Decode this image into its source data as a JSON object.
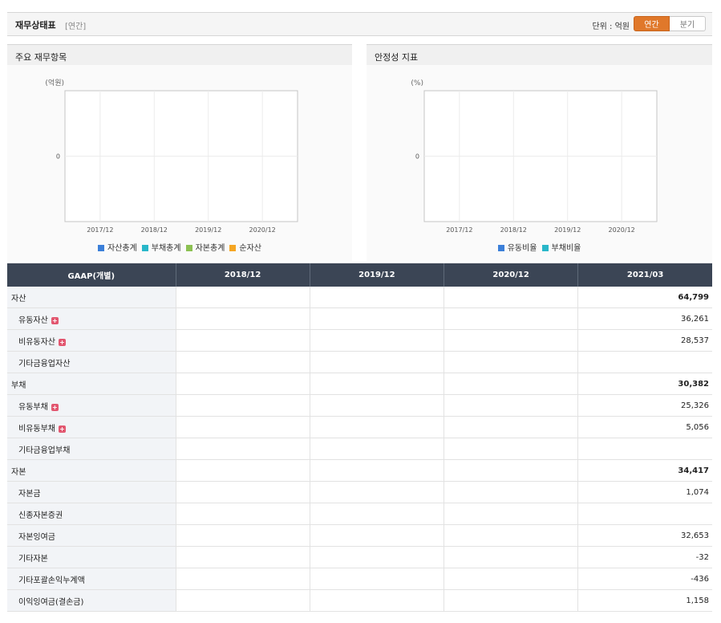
{
  "header": {
    "title": "재무상태표",
    "subtitle": "[연간]",
    "unit": "단위 : 억원",
    "toggle": {
      "annual": "연간",
      "quarter": "분기",
      "selected": "연간"
    }
  },
  "colors": {
    "accent": "#e0782a",
    "table_header_bg": "#3b4555",
    "negative": "#e03c3c",
    "legend_blue": "#3b7fd9",
    "legend_cyan": "#29b7c9",
    "legend_green": "#8cc152",
    "legend_orange": "#f5a623"
  },
  "chart_data": [
    {
      "type": "bar",
      "title": "주요 재무항목",
      "ylabel": "(억원)",
      "categories": [
        "2017/12",
        "2018/12",
        "2019/12",
        "2020/12"
      ],
      "y_ticks": [
        "0"
      ],
      "grid": true,
      "legend_position": "bottom",
      "series": [
        {
          "name": "자산총계",
          "color": "#3b7fd9",
          "values": []
        },
        {
          "name": "부채총계",
          "color": "#29b7c9",
          "values": []
        },
        {
          "name": "자본총계",
          "color": "#8cc152",
          "values": []
        },
        {
          "name": "순자산",
          "color": "#f5a623",
          "values": []
        }
      ]
    },
    {
      "type": "line",
      "title": "안정성 지표",
      "ylabel": "(%)",
      "categories": [
        "2017/12",
        "2018/12",
        "2019/12",
        "2020/12"
      ],
      "y_ticks": [
        "0"
      ],
      "grid": true,
      "legend_position": "bottom",
      "series": [
        {
          "name": "유동비율",
          "color": "#3b7fd9",
          "values": []
        },
        {
          "name": "부채비율",
          "color": "#29b7c9",
          "values": []
        }
      ]
    }
  ],
  "table": {
    "columns": [
      "GAAP(개별)",
      "2018/12",
      "2019/12",
      "2020/12",
      "2021/03"
    ],
    "rows": [
      {
        "label": "자산",
        "level": 0,
        "expand": false,
        "values": [
          "",
          "",
          "",
          "64,799"
        ]
      },
      {
        "label": "유동자산",
        "level": 1,
        "expand": true,
        "values": [
          "",
          "",
          "",
          "36,261"
        ]
      },
      {
        "label": "비유동자산",
        "level": 1,
        "expand": true,
        "values": [
          "",
          "",
          "",
          "28,537"
        ]
      },
      {
        "label": "기타금융업자산",
        "level": 1,
        "expand": false,
        "values": [
          "",
          "",
          "",
          ""
        ]
      },
      {
        "label": "부채",
        "level": 0,
        "expand": false,
        "values": [
          "",
          "",
          "",
          "30,382"
        ]
      },
      {
        "label": "유동부채",
        "level": 1,
        "expand": true,
        "values": [
          "",
          "",
          "",
          "25,326"
        ]
      },
      {
        "label": "비유동부채",
        "level": 1,
        "expand": true,
        "values": [
          "",
          "",
          "",
          "5,056"
        ]
      },
      {
        "label": "기타금융업부채",
        "level": 1,
        "expand": false,
        "values": [
          "",
          "",
          "",
          ""
        ]
      },
      {
        "label": "자본",
        "level": 0,
        "expand": false,
        "values": [
          "",
          "",
          "",
          "34,417"
        ]
      },
      {
        "label": "자본금",
        "level": 1,
        "expand": false,
        "values": [
          "",
          "",
          "",
          "1,074"
        ]
      },
      {
        "label": "신종자본증권",
        "level": 1,
        "expand": false,
        "values": [
          "",
          "",
          "",
          ""
        ]
      },
      {
        "label": "자본잉여금",
        "level": 1,
        "expand": false,
        "values": [
          "",
          "",
          "",
          "32,653"
        ]
      },
      {
        "label": "기타자본",
        "level": 1,
        "expand": false,
        "values": [
          "",
          "",
          "",
          "-32"
        ]
      },
      {
        "label": "기타포괄손익누계액",
        "level": 1,
        "expand": false,
        "values": [
          "",
          "",
          "",
          "-436"
        ]
      },
      {
        "label": "이익잉여금(결손금)",
        "level": 1,
        "expand": false,
        "values": [
          "",
          "",
          "",
          "1,158"
        ]
      }
    ]
  }
}
